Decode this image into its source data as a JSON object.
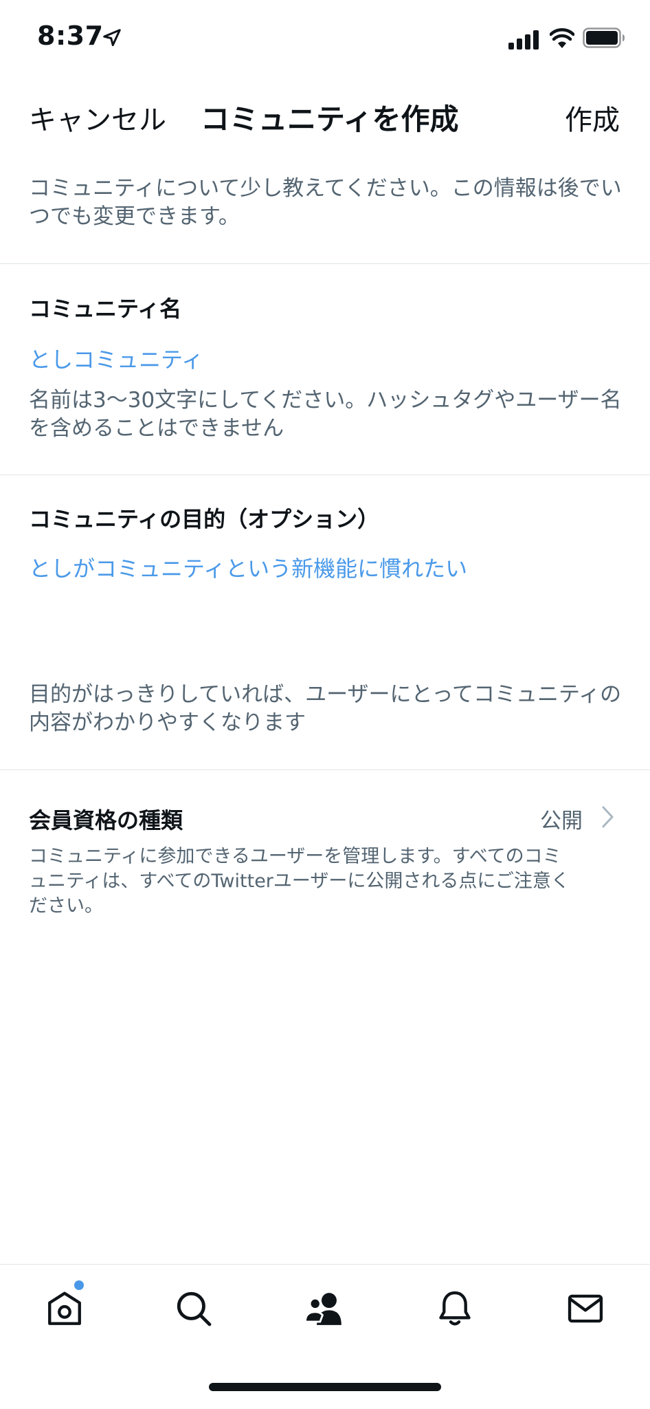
{
  "status_bar": {
    "time": "8:37"
  },
  "nav": {
    "cancel": "キャンセル",
    "title": "コミュニティを作成",
    "create": "作成"
  },
  "intro": "コミュニティについて少し教えてください。この情報は後でいつでも変更できます。",
  "name_section": {
    "label": "コミュニティ名",
    "value": "としコミュニティ",
    "help": "名前は3〜30文字にしてください。ハッシュタグやユーザー名を含めることはできません"
  },
  "purpose_section": {
    "label": "コミュニティの目的（オプション）",
    "value": "としがコミュニティという新機能に慣れたい",
    "help": "目的がはっきりしていれば、ユーザーにとってコミュニティの内容がわかりやすくなります"
  },
  "membership_section": {
    "label": "会員資格の種類",
    "value": "公開",
    "help": "コミュニティに参加できるユーザーを管理します。すべてのコミュニティは、すべてのTwitterユーザーに公開される点にご注意ください。"
  },
  "tabs": [
    "home-icon",
    "search-icon",
    "communities-icon",
    "notifications-icon",
    "messages-icon"
  ],
  "colors": {
    "accent": "#4a99e9",
    "secondary_text": "#536471"
  }
}
